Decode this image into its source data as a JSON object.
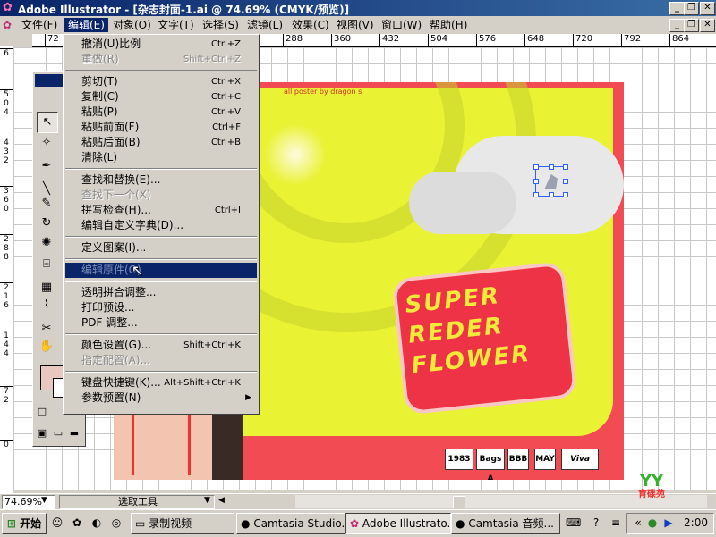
{
  "window": {
    "title": "Adobe Illustrator - [杂志封面-1.ai @ 74.69% (CMYK/预览)]",
    "controls": [
      "_",
      "❐",
      "✕"
    ],
    "doc_controls": [
      "_",
      "❐",
      "✕"
    ]
  },
  "menubar": [
    "文件(F)",
    "编辑(E)",
    "对象(O)",
    "文字(T)",
    "选择(S)",
    "滤镜(L)",
    "效果(C)",
    "视图(V)",
    "窗口(W)",
    "帮助(H)"
  ],
  "hruler": [
    "72",
    "288",
    "360",
    "432",
    "504",
    "576",
    "648",
    "720",
    "792",
    "864"
  ],
  "vruler": [
    "6",
    "5\n0\n4",
    "4\n3\n2",
    "3\n6\n0",
    "2\n8\n8",
    "2\n1\n6",
    "1\n4\n4",
    "7\n2",
    "0"
  ],
  "edit_menu": {
    "items": [
      {
        "label": "撤消(U)比例",
        "shortcut": "Ctrl+Z",
        "state": "normal"
      },
      {
        "label": "重做(R)",
        "shortcut": "Shift+Ctrl+Z",
        "state": "disabled"
      },
      {
        "sep": true
      },
      {
        "label": "剪切(T)",
        "shortcut": "Ctrl+X",
        "state": "normal"
      },
      {
        "label": "复制(C)",
        "shortcut": "Ctrl+C",
        "state": "normal"
      },
      {
        "label": "粘贴(P)",
        "shortcut": "Ctrl+V",
        "state": "normal"
      },
      {
        "label": "粘贴前面(F)",
        "shortcut": "Ctrl+F",
        "state": "normal"
      },
      {
        "label": "粘贴后面(B)",
        "shortcut": "Ctrl+B",
        "state": "normal"
      },
      {
        "label": "清除(L)",
        "shortcut": "",
        "state": "normal"
      },
      {
        "sep": true
      },
      {
        "label": "查找和替换(E)...",
        "shortcut": "",
        "state": "normal"
      },
      {
        "label": "查找下一个(X)",
        "shortcut": "",
        "state": "disabled"
      },
      {
        "label": "拼写检查(H)...",
        "shortcut": "Ctrl+I",
        "state": "normal"
      },
      {
        "label": "编辑自定义字典(D)...",
        "shortcut": "",
        "state": "normal"
      },
      {
        "sep": true
      },
      {
        "label": "定义图案(I)...",
        "shortcut": "",
        "state": "normal"
      },
      {
        "sep": true
      },
      {
        "label": "编辑原件(O)",
        "shortcut": "",
        "state": "highlighted"
      },
      {
        "sep": true
      },
      {
        "label": "透明拼合调整...",
        "shortcut": "",
        "state": "normal"
      },
      {
        "label": "打印预设...",
        "shortcut": "",
        "state": "normal"
      },
      {
        "label": "PDF 调整...",
        "shortcut": "",
        "state": "normal"
      },
      {
        "sep": true
      },
      {
        "label": "颜色设置(G)...",
        "shortcut": "Shift+Ctrl+K",
        "state": "normal"
      },
      {
        "label": "指定配置(A)...",
        "shortcut": "",
        "state": "disabled"
      },
      {
        "sep": true
      },
      {
        "label": "键盘快捷键(K)...",
        "shortcut": "Alt+Shift+Ctrl+K",
        "state": "normal"
      },
      {
        "label": "参数预置(N)",
        "shortcut": "",
        "state": "normal",
        "submenu": true
      }
    ]
  },
  "artwork": {
    "headline": [
      "SUPER",
      "REDER",
      "FLOWER"
    ],
    "caption": "all poster by dragon s",
    "logos": [
      "1983",
      "Bags A",
      "BBB",
      "MAY",
      "Viva"
    ]
  },
  "statusbar": {
    "zoom": "74.69%",
    "tool": "选取工具"
  },
  "watermark": {
    "logo": "YY",
    "text": "育碟苑"
  },
  "taskbar": {
    "start": "开始",
    "tasks": [
      {
        "label": "录制视频",
        "active": false
      },
      {
        "label": "Camtasia Studio...",
        "active": false
      },
      {
        "label": "Adobe Illustrato...",
        "active": true
      },
      {
        "label": "Camtasia 音频...",
        "active": false
      }
    ],
    "clock": "2:00"
  },
  "colors": {
    "title_bar": "#0a246a",
    "menu_highlight": "#0a246a",
    "art_red": "#f24b54",
    "art_yellow": "#e9f233"
  }
}
